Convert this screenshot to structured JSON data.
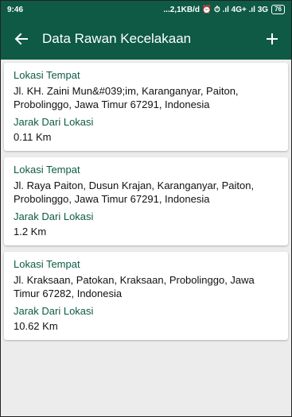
{
  "status_bar": {
    "time": "9:46",
    "right_text": "...2,1KB/d ⏰ ⏱ .ıl 4G+ .ıl 3G",
    "battery": "76"
  },
  "toolbar": {
    "title": "Data Rawan Kecelakaan",
    "back_icon": "arrow-left-icon",
    "add_icon": "plus-icon"
  },
  "colors": {
    "primary": "#0e5a45",
    "label": "#0e5a45",
    "background": "#ececec"
  },
  "cards": [
    {
      "location_label": "Lokasi Tempat",
      "address": "Jl. KH. Zaini Mun&#039;im, Karanganyar, Paiton, Probolinggo, Jawa Timur 67291, Indonesia",
      "distance_label": "Jarak Dari Lokasi",
      "distance": "0.11 Km"
    },
    {
      "location_label": "Lokasi Tempat",
      "address": "Jl. Raya Paiton, Dusun Krajan, Karanganyar, Paiton, Probolinggo, Jawa Timur 67291, Indonesia",
      "distance_label": "Jarak Dari Lokasi",
      "distance": "1.2 Km"
    },
    {
      "location_label": "Lokasi Tempat",
      "address": "Jl. Kraksaan, Patokan, Kraksaan, Probolinggo, Jawa Timur 67282, Indonesia",
      "distance_label": "Jarak Dari Lokasi",
      "distance": "10.62 Km"
    }
  ]
}
